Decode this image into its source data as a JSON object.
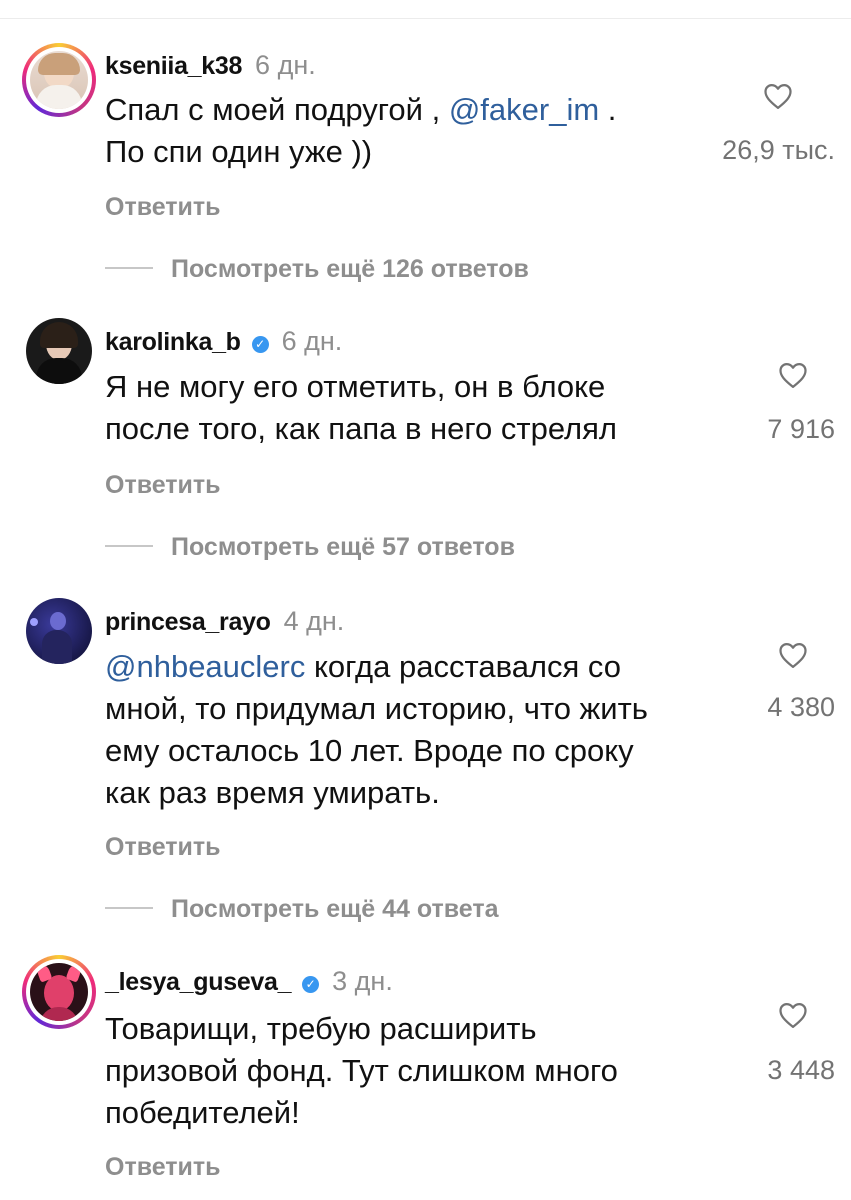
{
  "comments": [
    {
      "username": "kseniia_k38",
      "verified": false,
      "time": "6 дн.",
      "text_parts": [
        {
          "t": "Спал с моей подругой , "
        },
        {
          "t": "@faker_im",
          "mention": true
        },
        {
          "t": " ."
        },
        {
          "br": true
        },
        {
          "t": "По спи один уже ))"
        }
      ],
      "likes": "26,9 тыс.",
      "reply_label": "Ответить",
      "view_more": "Посмотреть ещё 126 ответов",
      "avatar_icon": "user-avatar-photo"
    },
    {
      "username": "karolinka_b",
      "verified": true,
      "time": "6 дн.",
      "text_parts": [
        {
          "t": "Я не могу его отметить, он в блоке"
        },
        {
          "br": true
        },
        {
          "t": "после того, как папа в него стрелял"
        }
      ],
      "likes": "7 916",
      "reply_label": "Ответить",
      "view_more": "Посмотреть ещё 57 ответов",
      "avatar_icon": "user-avatar-photo"
    },
    {
      "username": "princesa_rayo",
      "verified": false,
      "time": "4 дн.",
      "text_parts": [
        {
          "t": "@nhbeauclerc",
          "mention": true
        },
        {
          "t": " когда расставался со"
        },
        {
          "br": true
        },
        {
          "t": "мной, то придумал историю, что жить"
        },
        {
          "br": true
        },
        {
          "t": "ему осталось 10 лет. Вроде по сроку"
        },
        {
          "br": true
        },
        {
          "t": "как раз время умирать."
        }
      ],
      "likes": "4 380",
      "reply_label": "Ответить",
      "view_more": "Посмотреть ещё 44 ответа",
      "avatar_icon": "user-avatar-photo"
    },
    {
      "username": "_lesya_guseva_",
      "verified": true,
      "time": "3 дн.",
      "text_parts": [
        {
          "t": "Товарищи, требую расширить"
        },
        {
          "br": true
        },
        {
          "t": "призовой фонд. Тут слишком много"
        },
        {
          "br": true
        },
        {
          "t": "победителей!"
        }
      ],
      "likes": "3 448",
      "reply_label": "Ответить",
      "view_more": "",
      "avatar_icon": "user-avatar-photo"
    }
  ],
  "colors": {
    "mention": "#2f5f9c",
    "muted": "#8e8e8e",
    "verified": "#3897f0"
  },
  "icons": {
    "like": "heart-outline-icon",
    "verified": "verified-badge-icon"
  }
}
